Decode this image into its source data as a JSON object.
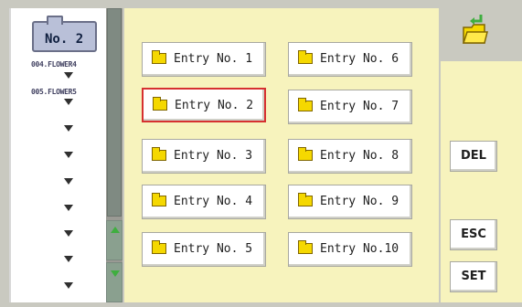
{
  "folder_tab": {
    "label": "No. 2"
  },
  "tree": {
    "items": [
      "004.FLOWER4",
      "005.FLOWER5"
    ]
  },
  "entries": [
    "Entry No. 1",
    "Entry No. 2",
    "Entry No. 3",
    "Entry No. 4",
    "Entry No. 5",
    "Entry No. 6",
    "Entry No. 7",
    "Entry No. 8",
    "Entry No. 9",
    "Entry No.10"
  ],
  "selected_entry": "Entry No. 2",
  "buttons": {
    "del": "DEL",
    "esc": "ESC",
    "set": "SET"
  },
  "icons": {
    "folder_back": "folder-back-icon",
    "entry_folder": "folder-icon",
    "scroll_up": "chevron-up-icon",
    "scroll_down": "chevron-down-icon",
    "tree_arrow": "arrow-down-icon"
  },
  "colors": {
    "main_bg": "#f7f3bd",
    "selected_border": "#d63030",
    "folder_fill": "#f5d800",
    "scroll_arrow": "#3fae3f"
  }
}
